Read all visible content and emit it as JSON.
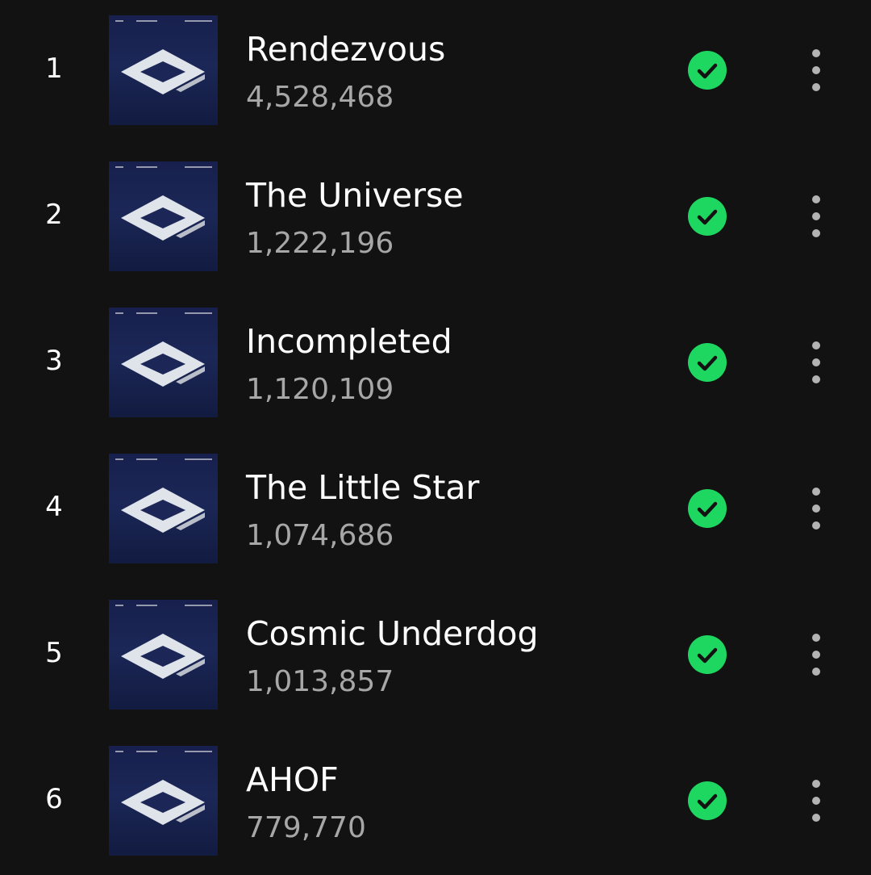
{
  "tracks": [
    {
      "number": "1",
      "title": "Rendezvous",
      "plays": "4,528,468",
      "saved": true,
      "icon": "check-circle-icon"
    },
    {
      "number": "2",
      "title": "The Universe",
      "plays": "1,222,196",
      "saved": true,
      "icon": "check-circle-icon"
    },
    {
      "number": "3",
      "title": "Incompleted",
      "plays": "1,120,109",
      "saved": true,
      "icon": "check-circle-icon"
    },
    {
      "number": "4",
      "title": "The Little Star",
      "plays": "1,074,686",
      "saved": true,
      "icon": "check-circle-icon"
    },
    {
      "number": "5",
      "title": "Cosmic Underdog",
      "plays": "1,013,857",
      "saved": true,
      "icon": "check-circle-icon"
    },
    {
      "number": "6",
      "title": "AHOF",
      "plays": "779,770",
      "saved": true,
      "icon": "check-circle-icon"
    }
  ],
  "more_icon": "more-vertical-icon",
  "colors": {
    "background": "#121212",
    "title": "#ffffff",
    "subtext": "#a7a7a7",
    "accent": "#1ed760",
    "cover": "#1b2757"
  }
}
